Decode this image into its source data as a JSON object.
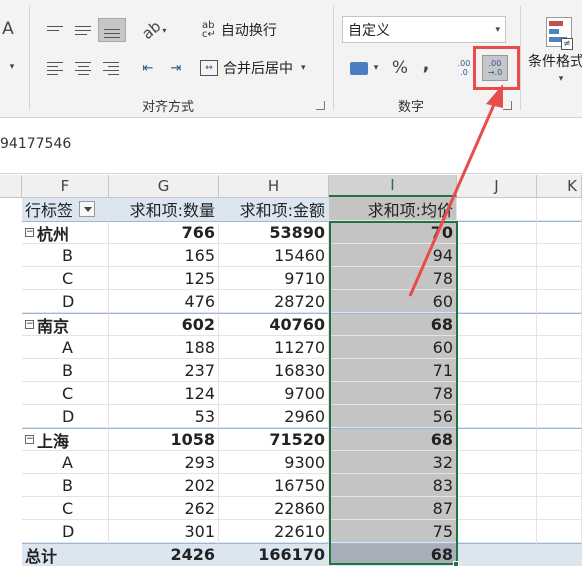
{
  "ribbon": {
    "wrap_text": "自动换行",
    "merge_center": "合并后居中",
    "alignment_group": "对齐方式",
    "number_format_value": "自定义",
    "number_group": "数字",
    "percent": "%",
    "comma": ",",
    "cond_format": "条件格式",
    "font_a": "A",
    "inc_decimal_top": ".00",
    "inc_decimal_bottom": ".0",
    "dec_decimal_top": ".00",
    "dec_decimal_bottom": "→.0",
    "highlight_color": "#e84c4c"
  },
  "formula_bar": {
    "value": "94177546"
  },
  "columns": [
    "F",
    "G",
    "H",
    "I",
    "J",
    "K"
  ],
  "table": {
    "header": {
      "label": "行标签",
      "qty": "求和项:数量",
      "amount": "求和项:金额",
      "avg": "求和项:均价"
    },
    "rows": [
      {
        "type": "grp",
        "label": "杭州",
        "qty": "766",
        "amount": "53890",
        "avg": "70"
      },
      {
        "type": "sub",
        "label": "B",
        "qty": "165",
        "amount": "15460",
        "avg": "94"
      },
      {
        "type": "sub",
        "label": "C",
        "qty": "125",
        "amount": "9710",
        "avg": "78"
      },
      {
        "type": "sub",
        "label": "D",
        "qty": "476",
        "amount": "28720",
        "avg": "60"
      },
      {
        "type": "grp",
        "label": "南京",
        "qty": "602",
        "amount": "40760",
        "avg": "68"
      },
      {
        "type": "sub",
        "label": "A",
        "qty": "188",
        "amount": "11270",
        "avg": "60"
      },
      {
        "type": "sub",
        "label": "B",
        "qty": "237",
        "amount": "16830",
        "avg": "71"
      },
      {
        "type": "sub",
        "label": "C",
        "qty": "124",
        "amount": "9700",
        "avg": "78"
      },
      {
        "type": "sub",
        "label": "D",
        "qty": "53",
        "amount": "2960",
        "avg": "56"
      },
      {
        "type": "grp",
        "label": "上海",
        "qty": "1058",
        "amount": "71520",
        "avg": "68"
      },
      {
        "type": "sub",
        "label": "A",
        "qty": "293",
        "amount": "9300",
        "avg": "32"
      },
      {
        "type": "sub",
        "label": "B",
        "qty": "202",
        "amount": "16750",
        "avg": "83"
      },
      {
        "type": "sub",
        "label": "C",
        "qty": "262",
        "amount": "22860",
        "avg": "87"
      },
      {
        "type": "sub",
        "label": "D",
        "qty": "301",
        "amount": "22610",
        "avg": "75"
      },
      {
        "type": "tot",
        "label": "总计",
        "qty": "2426",
        "amount": "166170",
        "avg": "68"
      }
    ]
  }
}
